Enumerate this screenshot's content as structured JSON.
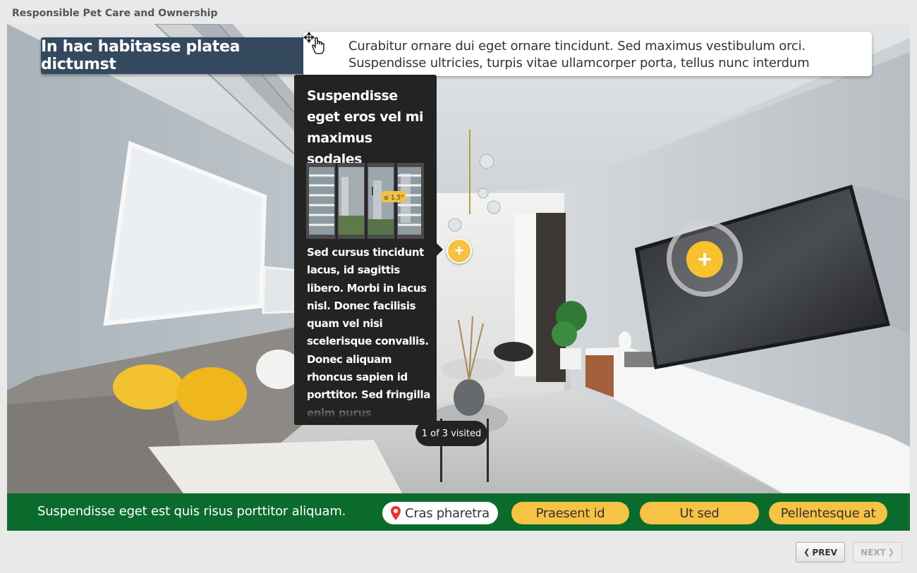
{
  "course_title": "Responsible Pet Care and Ownership",
  "slide_title": "In hac habitasse platea dictumst",
  "instructions": "Curabitur ornare dui eget ornare tincidunt. Sed maximus vestibulum orci. Suspendisse ultricies, turpis vitae ullamcorper porta, tellus nunc interdum augue.",
  "popup": {
    "heading": "Suspendisse eget eros vel mi maximus sodales",
    "image_badge": "≤ 1.5\"",
    "body": "Sed cursus tincidunt lacus, id sagittis libero. Morbi in lacus nisl. Donec facilisis quam vel nisi scelerisque convallis. Donec aliquam rhoncus sapien id porttitor. Sed fringilla enim purus"
  },
  "visited_badge": "1 of 3 visited",
  "bottom_bar": {
    "text": "Suspendisse eget est quis risus porttitor aliquam.",
    "location_pill": "Cras pharetra",
    "pills": [
      "Praesent id",
      "Ut sed",
      "Pellentesque at"
    ]
  },
  "nav": {
    "prev": "PREV",
    "next": "NEXT"
  },
  "colors": {
    "title_bg": "#34495e",
    "bar_green": "#0b6b2c",
    "hotspot_yellow": "#f7c12f",
    "popup_bg": "#232323"
  }
}
